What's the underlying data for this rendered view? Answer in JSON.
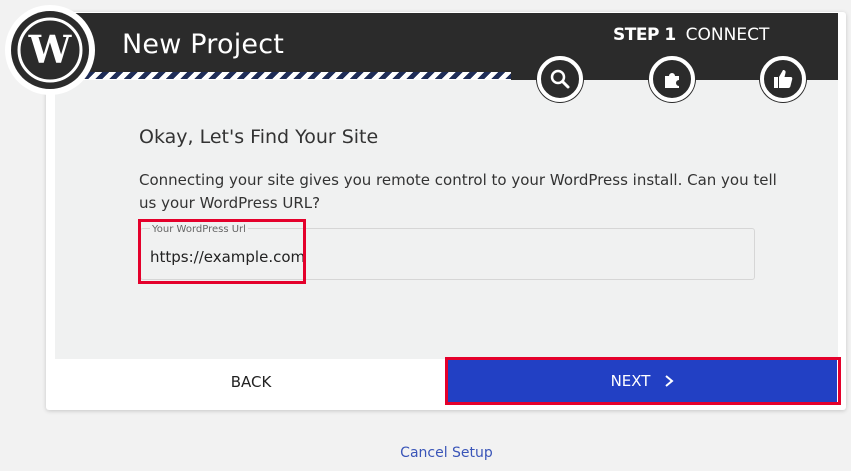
{
  "header": {
    "title": "New Project",
    "step_number": "STEP 1",
    "step_name": "CONNECT",
    "step_icons": [
      "search-icon",
      "puzzle-icon",
      "thumbs-up-icon"
    ],
    "logo": "wordpress-logo"
  },
  "main": {
    "heading": "Okay, Let's Find Your Site",
    "description": "Connecting your site gives you remote control to your WordPress install. Can you tell us your WordPress URL?",
    "url_field": {
      "label": "Your WordPress Url",
      "value": "https://example.com"
    }
  },
  "footer": {
    "back_label": "BACK",
    "next_label": "NEXT",
    "cancel_label": "Cancel Setup"
  },
  "colors": {
    "header_bg": "#2b2b2b",
    "next_bg": "#2240c4",
    "highlight": "#e4002b",
    "link": "#3a55b8"
  }
}
